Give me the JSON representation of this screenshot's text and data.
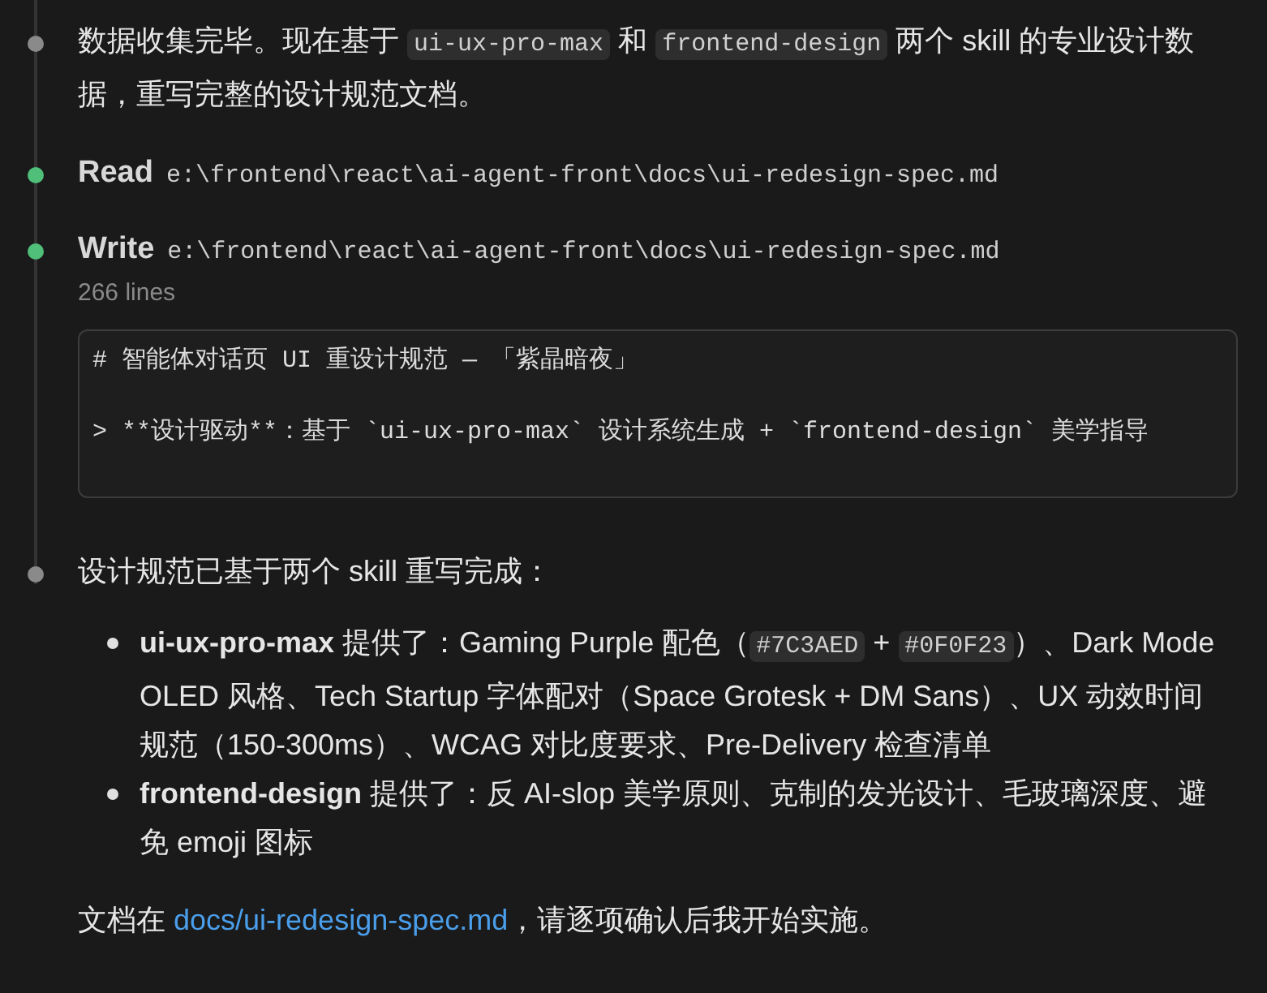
{
  "timeline": [
    {
      "kind": "message",
      "color": "#8a8a8a",
      "paragraphs": [
        {
          "segments": [
            {
              "kind": "text",
              "text": "数据收集完毕。现在基于 "
            },
            {
              "kind": "code",
              "text": "ui-ux-pro-max"
            },
            {
              "kind": "text",
              "text": " 和 "
            },
            {
              "kind": "code",
              "text": "frontend-design"
            },
            {
              "kind": "text",
              "text": " 两个 skill 的专业设计数据，重写完整的设计规范文档。"
            }
          ]
        }
      ]
    },
    {
      "kind": "tool",
      "color": "#4fbf7a",
      "action": "Read",
      "path": "e:\\frontend\\react\\ai-agent-front\\docs\\ui-redesign-spec.md"
    },
    {
      "kind": "tool",
      "color": "#4fbf7a",
      "action": "Write",
      "path": "e:\\frontend\\react\\ai-agent-front\\docs\\ui-redesign-spec.md",
      "meta": "266 lines",
      "preview": [
        "# 智能体对话页 UI 重设计规范 — 「紫晶暗夜」",
        "> **设计驱动**：基于 `ui-ux-pro-max` 设计系统生成 + `frontend-design` 美学指导"
      ]
    },
    {
      "kind": "message",
      "color": "#8a8a8a",
      "paragraphs": [
        {
          "segments": [
            {
              "kind": "text",
              "text": "设计规范已基于两个 skill 重写完成："
            }
          ]
        }
      ],
      "bullets": [
        {
          "segments": [
            {
              "kind": "text",
              "text": "**ui-ux-pro-max** 提供了：Gaming Purple 配色（"
            },
            {
              "kind": "code",
              "text": "#7C3AED"
            },
            {
              "kind": "text",
              "text": " + "
            },
            {
              "kind": "code",
              "text": "#0F0F23"
            },
            {
              "kind": "text",
              "text": "）、Dark Mode OLED 风格、Tech Startup 字体配对（Space Grotesk + DM Sans）、UX 动效时间规范（150-300ms）、WCAG 对比度要求、Pre-Delivery 检查清单"
            }
          ]
        },
        {
          "segments": [
            {
              "kind": "text",
              "text": "**frontend-design** 提供了：反 AI-slop 美学原则、克制的发光设计、毛玻璃深度、避免 emoji 图标"
            }
          ]
        }
      ],
      "closing": {
        "segments": [
          {
            "kind": "text",
            "text": "文档在 "
          },
          {
            "kind": "link",
            "text": "docs/ui-redesign-spec.md"
          },
          {
            "kind": "text",
            "text": "，请逐项确认后我开始实施。"
          }
        ]
      }
    }
  ]
}
